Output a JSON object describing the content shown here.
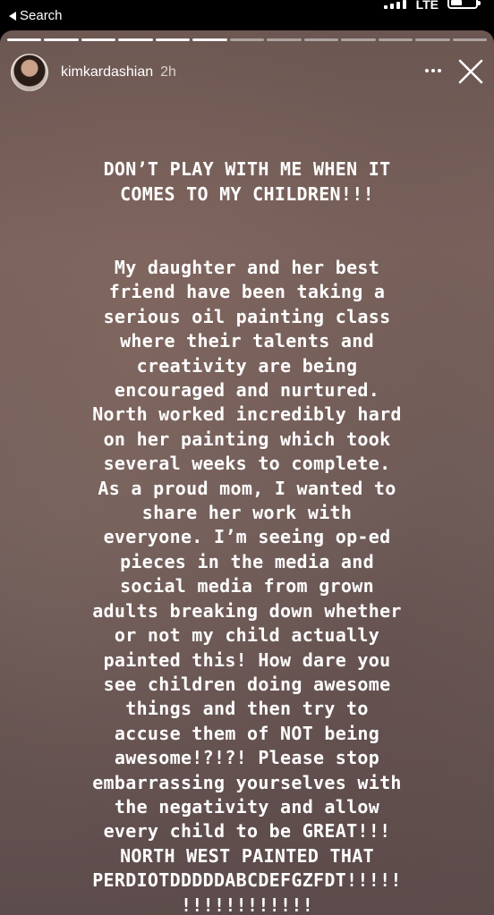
{
  "status_bar": {
    "back_label": "Search",
    "network": "LTE"
  },
  "story": {
    "progress_segments": 13,
    "progress_viewed": 6,
    "username": "kimkardashian",
    "timestamp": "2h",
    "headline": "DON’T PLAY WITH ME WHEN IT\nCOMES TO MY CHILDREN!!!",
    "body": "My daughter and her best\nfriend have been taking a\nserious oil painting class\nwhere their talents and\ncreativity are being\nencouraged and nurtured.\nNorth worked incredibly hard\non her painting which took\nseveral weeks to complete.\nAs a proud mom, I wanted to\nshare her work with\neveryone. I’m seeing op-ed\npieces in the media and\nsocial media from grown\nadults breaking down whether\nor not my child actually\npainted this! How dare you\nsee children doing awesome\nthings and then try to\naccuse them of NOT being\nawesome!?!?!  Please stop\nembarrassing yourselves with\nthe negativity and allow\nevery child to be GREAT!!!\nNORTH WEST PAINTED THAT\nPERDIOTDDDDDABCDEFGZFDT!!!!!\n!!!!!!!!!!!!"
  },
  "colors": {
    "story_bg": "#73605c",
    "text": "#ffffff"
  },
  "icons": {
    "back": "back-arrow-icon",
    "more": "more-options-icon",
    "close": "close-icon"
  }
}
